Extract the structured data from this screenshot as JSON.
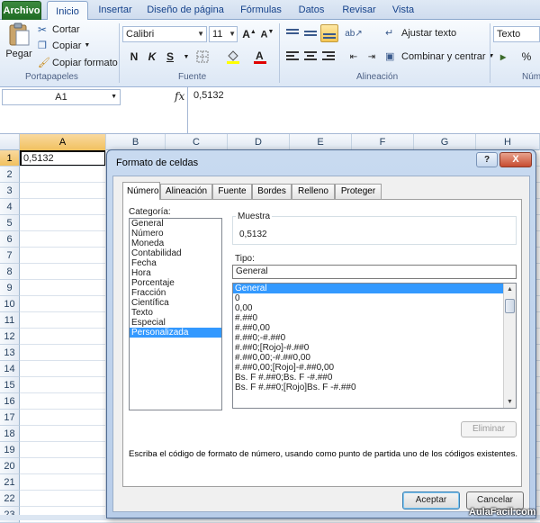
{
  "ribbon_tabs": [
    "Archivo",
    "Inicio",
    "Insertar",
    "Diseño de página",
    "Fórmulas",
    "Datos",
    "Revisar",
    "Vista"
  ],
  "clipboard": {
    "paste_label": "Pegar",
    "cut_label": "Cortar",
    "copy_label": "Copiar",
    "format_painter_label": "Copiar formato",
    "group_label": "Portapapeles"
  },
  "font": {
    "font_name": "Calibri",
    "font_size": "11",
    "bold": "N",
    "italic": "K",
    "underline": "S",
    "group_label": "Fuente"
  },
  "alignment": {
    "wrap_text_label": "Ajustar texto",
    "merge_label": "Combinar y centrar",
    "group_label": "Alineación"
  },
  "number": {
    "format_value": "Texto",
    "group_label": "Núm",
    "percent": "%"
  },
  "formula_bar": {
    "name_box": "A1",
    "fx": "fx",
    "value": "0,5132"
  },
  "grid": {
    "columns": [
      "A",
      "B",
      "C",
      "D",
      "E",
      "F",
      "G",
      "H"
    ],
    "rows": [
      "1",
      "2",
      "3",
      "4",
      "5",
      "6",
      "7",
      "8",
      "9",
      "10",
      "11",
      "12",
      "13",
      "14",
      "15",
      "16",
      "17",
      "18",
      "19",
      "20",
      "21",
      "22",
      "23"
    ],
    "cell_a1": "0,5132"
  },
  "dialog": {
    "title": "Formato de celdas",
    "help": "?",
    "close": "X",
    "tabs": [
      "Número",
      "Alineación",
      "Fuente",
      "Bordes",
      "Relleno",
      "Proteger"
    ],
    "category_label": "Categoría:",
    "categories": [
      "General",
      "Número",
      "Moneda",
      "Contabilidad",
      "Fecha",
      "Hora",
      "Porcentaje",
      "Fracción",
      "Científica",
      "Texto",
      "Especial",
      "Personalizada"
    ],
    "selected_category": "Personalizada",
    "sample_label": "Muestra",
    "sample_value": "0,5132",
    "type_label": "Tipo:",
    "type_value": "General",
    "formats": [
      "General",
      "0",
      "0,00",
      "#.##0",
      "#.##0,00",
      "#.##0;-#.##0",
      "#.##0;[Rojo]-#.##0",
      "#.##0,00;-#.##0,00",
      "#.##0,00;[Rojo]-#.##0,00",
      "Bs. F #.##0;Bs. F -#.##0",
      "Bs. F #.##0;[Rojo]Bs. F -#.##0"
    ],
    "selected_format": "General",
    "delete_label": "Eliminar",
    "help_text": "Escriba el código de formato de número, usando como punto de partida uno de los códigos existentes.",
    "ok_label": "Aceptar",
    "cancel_label": "Cancelar"
  },
  "watermark": "AulaFacil.com"
}
